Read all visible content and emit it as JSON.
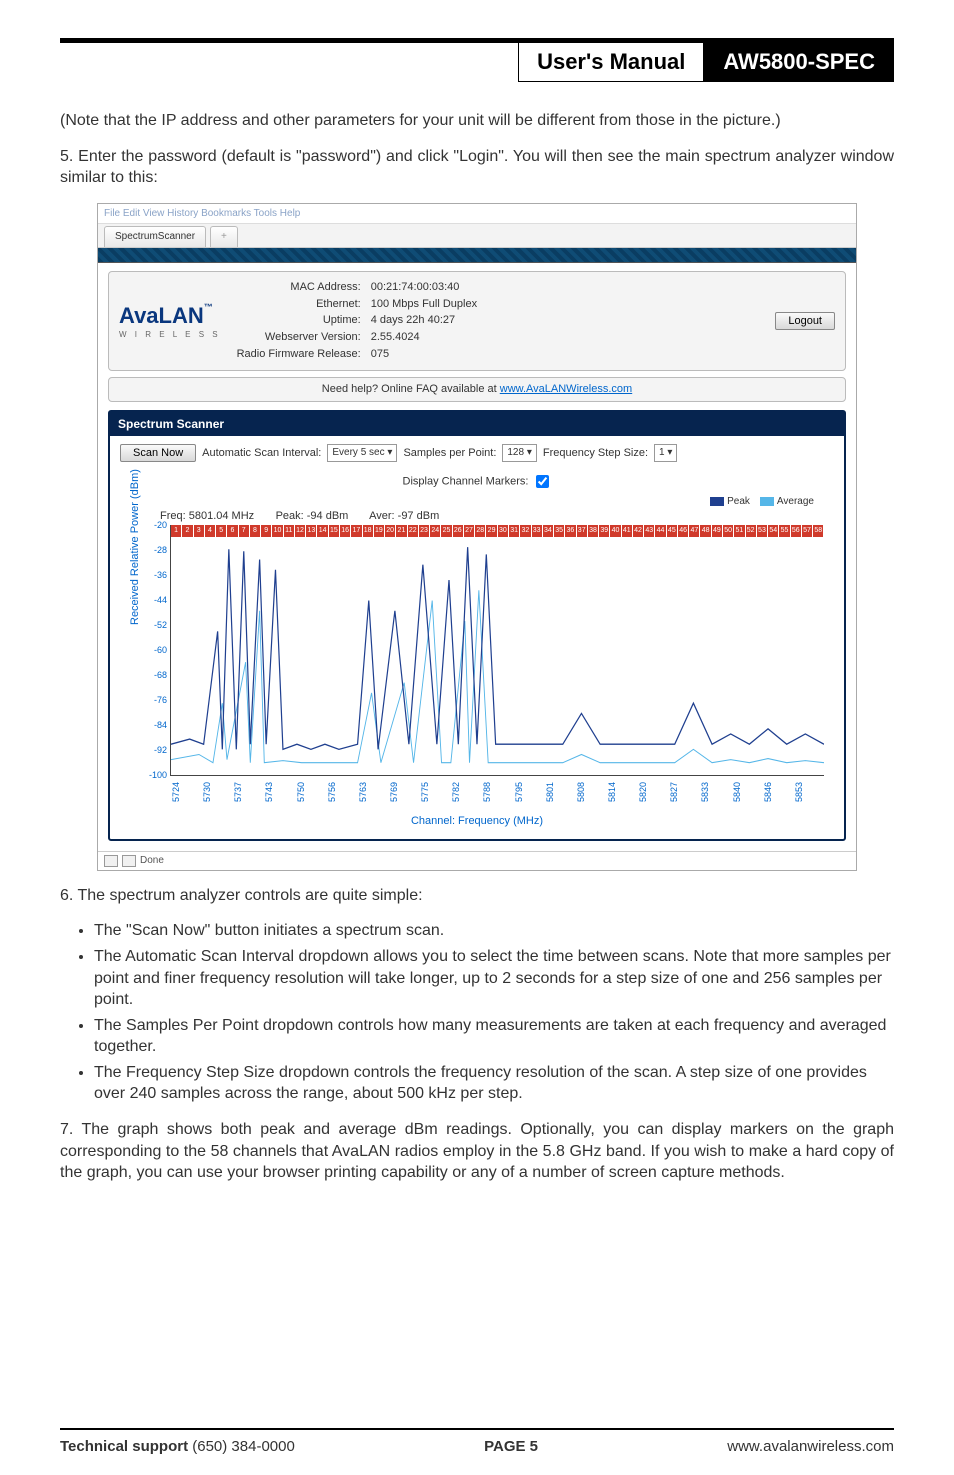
{
  "header": {
    "manual": "User's Manual",
    "model": "AW5800-SPEC"
  },
  "intro": {
    "note": "(Note that the IP address and other parameters for your unit will be different from those in the picture.)",
    "step5": "5. Enter the password (default is \"password\") and click \"Login\". You will then see the main spectrum analyzer window similar to this:"
  },
  "screenshot": {
    "ff_menu": "File  Edit  View  History  Bookmarks  Tools  Help",
    "tab": "SpectrumScanner",
    "newtab": "+",
    "logo_main": "AvaLAN",
    "logo_tm": "™",
    "logo_sub": "W I R E L E S S",
    "mac_k": "MAC Address:",
    "mac_v": "00:21:74:00:03:40",
    "eth_k": "Ethernet:",
    "eth_v": "100 Mbps Full Duplex",
    "up_k": "Uptime:",
    "up_v": "4 days 22h 40:27",
    "ws_k": "Webserver Version:",
    "ws_v": "2.55.4024",
    "fw_k": "Radio Firmware Release:",
    "fw_v": "075",
    "logout": "Logout",
    "faq_pre": "Need help?   Online FAQ available at ",
    "faq_link": "www.AvaLANWireless.com",
    "panel_title": "Spectrum Scanner",
    "scan_now": "Scan Now",
    "asi_l": "Automatic Scan Interval:",
    "asi_v": "Every 5 sec",
    "spp_l": "Samples per Point:",
    "spp_v": "128",
    "fss_l": "Frequency Step Size:",
    "fss_v": "1",
    "markers_l": "Display Channel Markers:",
    "legend_peak": "Peak",
    "legend_avg": "Average",
    "meta_freq": "Freq: 5801.04 MHz",
    "meta_peak": "Peak: -94 dBm",
    "meta_aver": "Aver: -97 dBm",
    "ylabel": "Received Relative Power (dBm)",
    "xlabel": "Channel: Frequency (MHz)",
    "status": "Done"
  },
  "chart_data": {
    "type": "line",
    "title": "Spectrum Scanner",
    "ylabel": "Received Relative Power (dBm)",
    "xlabel": "Channel: Frequency (MHz)",
    "ylim": [
      -100,
      -20
    ],
    "y_ticks": [
      -20,
      -28,
      -36,
      -44,
      -52,
      -60,
      -68,
      -76,
      -84,
      -92,
      -100
    ],
    "x_ticks": [
      5724,
      5730,
      5737,
      5743,
      5750,
      5756,
      5763,
      5769,
      5775,
      5782,
      5788,
      5795,
      5801,
      5808,
      5814,
      5820,
      5827,
      5833,
      5840,
      5846,
      5853
    ],
    "channel_markers": [
      1,
      2,
      3,
      4,
      5,
      6,
      7,
      8,
      9,
      10,
      11,
      12,
      13,
      14,
      15,
      16,
      17,
      18,
      19,
      20,
      21,
      22,
      23,
      24,
      25,
      26,
      27,
      28,
      29,
      30,
      31,
      32,
      33,
      34,
      35,
      36,
      37,
      38,
      39,
      40,
      41,
      42,
      43,
      44,
      45,
      46,
      47,
      48,
      49,
      50,
      51,
      52,
      53,
      54,
      55,
      56,
      57,
      58
    ],
    "series": [
      {
        "name": "Peak",
        "color": "#1f3f8f",
        "approx": true,
        "notable_peaks": {
          "5735": -22,
          "5745": -30,
          "5780": -28,
          "5790": -24,
          "5801": -94
        }
      },
      {
        "name": "Average",
        "color": "#55b6e8",
        "approx": true,
        "baseline": -94
      }
    ]
  },
  "after": {
    "step6": "6. The spectrum analyzer controls are quite simple:",
    "bullets": [
      "The \"Scan Now\" button initiates a spectrum scan.",
      "The Automatic Scan Interval dropdown allows you to select the time between scans. Note that more samples per point and finer frequency resolution will take longer, up to 2 seconds for a step size of one and 256 samples per point.",
      "The Samples Per Point dropdown controls how many measurements are taken at each frequency and averaged together.",
      "The Frequency Step Size dropdown controls the frequency resolution of the scan. A step size of one provides over 240 samples across the range, about 500 kHz per step."
    ],
    "step7": "7. The graph shows both peak and average dBm readings. Optionally, you can display markers on the graph corresponding to the 58 channels that AvaLAN radios employ in the 5.8 GHz band. If you wish to make a hard copy of the graph, you can use your browser printing capability or any of a number of screen capture methods."
  },
  "footer": {
    "left": "Technical support (650) 384-0000",
    "center": "PAGE 5",
    "right": "www.avalanwireless.com"
  }
}
